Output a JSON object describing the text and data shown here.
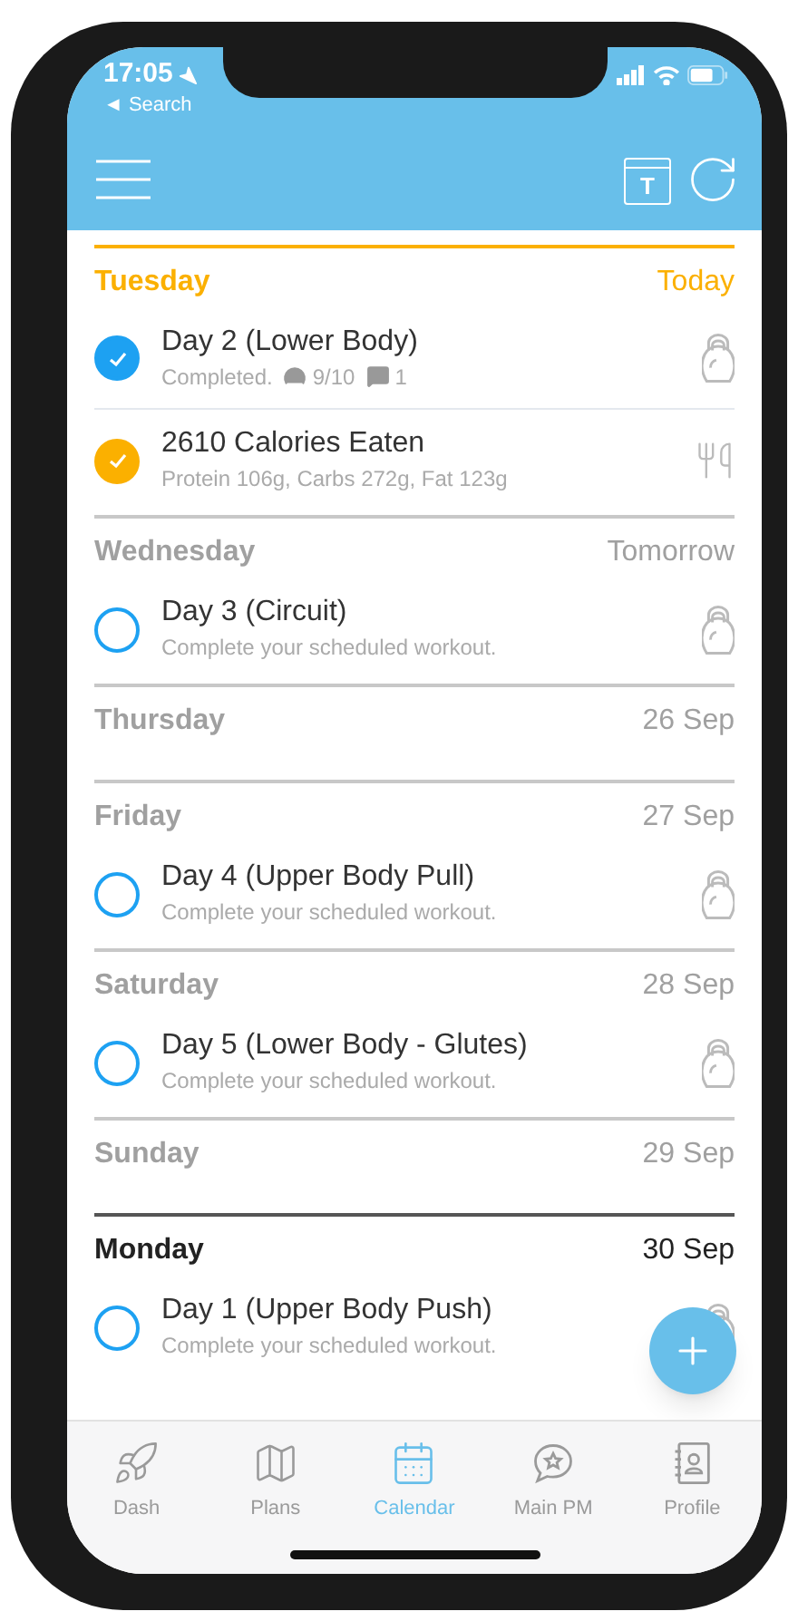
{
  "status_bar": {
    "time": "17:05",
    "back_link": "◄ Search"
  },
  "header": {
    "calendar_icon_letter": "T"
  },
  "days": [
    {
      "name": "Tuesday",
      "date": "Today",
      "kind": "today",
      "items": [
        {
          "kind": "workout",
          "title": "Day 2 (Lower Body)",
          "subtitle": "Completed.",
          "rating": "9/10",
          "comments": "1",
          "checked": true,
          "color": "#1da1f2"
        },
        {
          "kind": "nutrition",
          "title": "2610 Calories Eaten",
          "subtitle": "Protein 106g, Carbs 272g, Fat 123g",
          "checked": true,
          "color": "#fbb000"
        }
      ]
    },
    {
      "name": "Wednesday",
      "date": "Tomorrow",
      "kind": "upcoming",
      "items": [
        {
          "kind": "workout",
          "title": "Day 3 (Circuit)",
          "subtitle": "Complete your scheduled workout.",
          "checked": false,
          "color": "#1da1f2"
        }
      ]
    },
    {
      "name": "Thursday",
      "date": "26 Sep",
      "kind": "upcoming"
    },
    {
      "name": "Friday",
      "date": "27 Sep",
      "kind": "upcoming",
      "items": [
        {
          "kind": "workout",
          "title": "Day 4 (Upper Body Pull)",
          "subtitle": "Complete your scheduled workout.",
          "checked": false,
          "color": "#1da1f2"
        }
      ]
    },
    {
      "name": "Saturday",
      "date": "28 Sep",
      "kind": "upcoming",
      "items": [
        {
          "kind": "workout",
          "title": "Day 5 (Lower Body - Glutes)",
          "subtitle": "Complete your scheduled workout.",
          "checked": false,
          "color": "#1da1f2"
        }
      ]
    },
    {
      "name": "Sunday",
      "date": "29 Sep",
      "kind": "upcoming"
    },
    {
      "name": "Monday",
      "date": "30 Sep",
      "kind": "week_start",
      "items": [
        {
          "kind": "workout",
          "title": "Day 1 (Upper Body Push)",
          "subtitle": "Complete your scheduled workout.",
          "checked": false,
          "color": "#1da1f2"
        }
      ]
    }
  ],
  "tabs": [
    {
      "label": "Dash",
      "selected": false
    },
    {
      "label": "Plans",
      "selected": false
    },
    {
      "label": "Calendar",
      "selected": true
    },
    {
      "label": "Main PM",
      "selected": false
    },
    {
      "label": "Profile",
      "selected": false
    }
  ]
}
